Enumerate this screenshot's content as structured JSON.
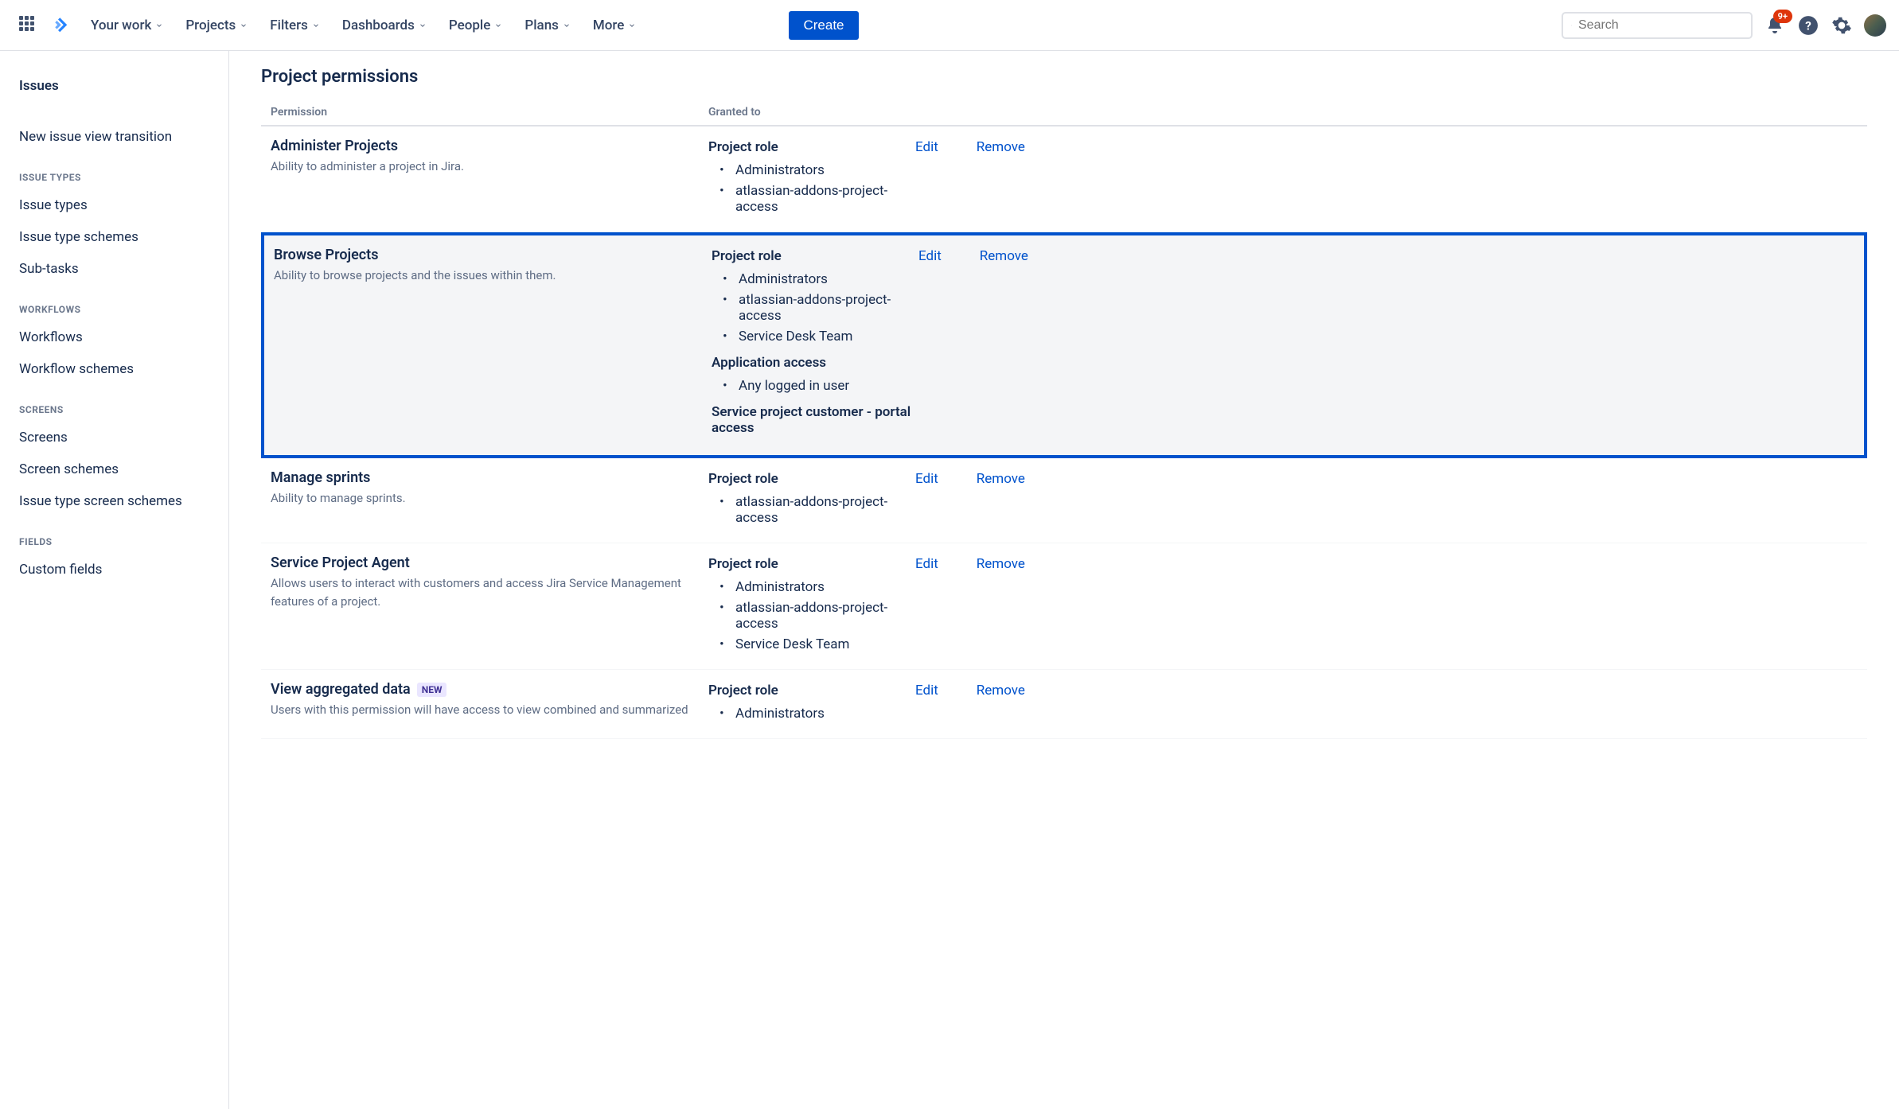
{
  "topnav": {
    "items": [
      {
        "label": "Your work"
      },
      {
        "label": "Projects"
      },
      {
        "label": "Filters"
      },
      {
        "label": "Dashboards"
      },
      {
        "label": "People"
      },
      {
        "label": "Plans"
      },
      {
        "label": "More"
      }
    ],
    "create_label": "Create",
    "search_placeholder": "Search",
    "badge": "9+"
  },
  "sidebar": {
    "issues_label": "Issues",
    "new_issue_view_label": "New issue view transition",
    "heading_issue_types": "ISSUE TYPES",
    "issue_types_label": "Issue types",
    "issue_type_schemes_label": "Issue type schemes",
    "sub_tasks_label": "Sub-tasks",
    "heading_workflows": "WORKFLOWS",
    "workflows_label": "Workflows",
    "workflow_schemes_label": "Workflow schemes",
    "heading_screens": "SCREENS",
    "screens_label": "Screens",
    "screen_schemes_label": "Screen schemes",
    "issue_type_screen_schemes_label": "Issue type screen schemes",
    "heading_fields": "FIELDS",
    "custom_fields_label": "Custom fields"
  },
  "main": {
    "title": "Project permissions",
    "col_permission": "Permission",
    "col_granted_to": "Granted to",
    "edit_label": "Edit",
    "remove_label": "Remove",
    "new_label": "NEW",
    "permissions": [
      {
        "name": "Administer Projects",
        "desc": "Ability to administer a project in Jira.",
        "highlighted": false,
        "grants": [
          {
            "heading": "Project role",
            "items": [
              "Administrators",
              "atlassian-addons-project-access"
            ]
          }
        ]
      },
      {
        "name": "Browse Projects",
        "desc": "Ability to browse projects and the issues within them.",
        "highlighted": true,
        "grants": [
          {
            "heading": "Project role",
            "items": [
              "Administrators",
              "atlassian-addons-project-access",
              "Service Desk Team"
            ]
          },
          {
            "heading": "Application access",
            "items": [
              "Any logged in user"
            ]
          },
          {
            "heading": "Service project customer - portal access",
            "items": []
          }
        ]
      },
      {
        "name": "Manage sprints",
        "desc": "Ability to manage sprints.",
        "highlighted": false,
        "grants": [
          {
            "heading": "Project role",
            "items": [
              "atlassian-addons-project-access"
            ]
          }
        ]
      },
      {
        "name": "Service Project Agent",
        "desc": "Allows users to interact with customers and access Jira Service Management features of a project.",
        "highlighted": false,
        "grants": [
          {
            "heading": "Project role",
            "items": [
              "Administrators",
              "atlassian-addons-project-access",
              "Service Desk Team"
            ]
          }
        ]
      },
      {
        "name": "View aggregated data",
        "desc": "Users with this permission will have access to view combined and summarized",
        "highlighted": false,
        "new": true,
        "grants": [
          {
            "heading": "Project role",
            "items": [
              "Administrators"
            ]
          }
        ]
      }
    ]
  }
}
